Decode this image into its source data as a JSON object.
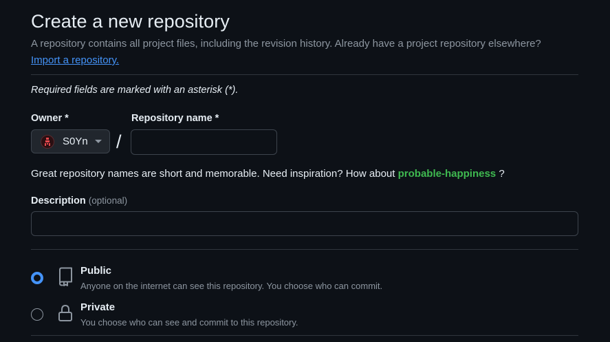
{
  "header": {
    "title": "Create a new repository",
    "subtitle": "A repository contains all project files, including the revision history. Already have a project repository elsewhere?",
    "import_link": "Import a repository."
  },
  "form": {
    "required_note": "Required fields are marked with an asterisk (*).",
    "owner_label": "Owner *",
    "owner_value": "S0Yn",
    "repo_label": "Repository name *",
    "repo_value": "",
    "separator": "/",
    "hint_text": "Great repository names are short and memorable. Need inspiration? How about",
    "suggestion": "probable-happiness",
    "hint_end": " ?",
    "description_label": "Description",
    "description_optional": "(optional)",
    "description_value": ""
  },
  "visibility": {
    "options": [
      {
        "title": "Public",
        "description": "Anyone on the internet can see this repository. You choose who can commit.",
        "selected": true,
        "icon": "repo-icon"
      },
      {
        "title": "Private",
        "description": "You choose who can see and commit to this repository.",
        "selected": false,
        "icon": "lock-icon"
      }
    ]
  },
  "colors": {
    "background": "#0d1117",
    "accent_blue": "#4493f8",
    "suggestion_green": "#3fb950",
    "muted_text": "#8d96a0",
    "border": "#3d444d"
  }
}
